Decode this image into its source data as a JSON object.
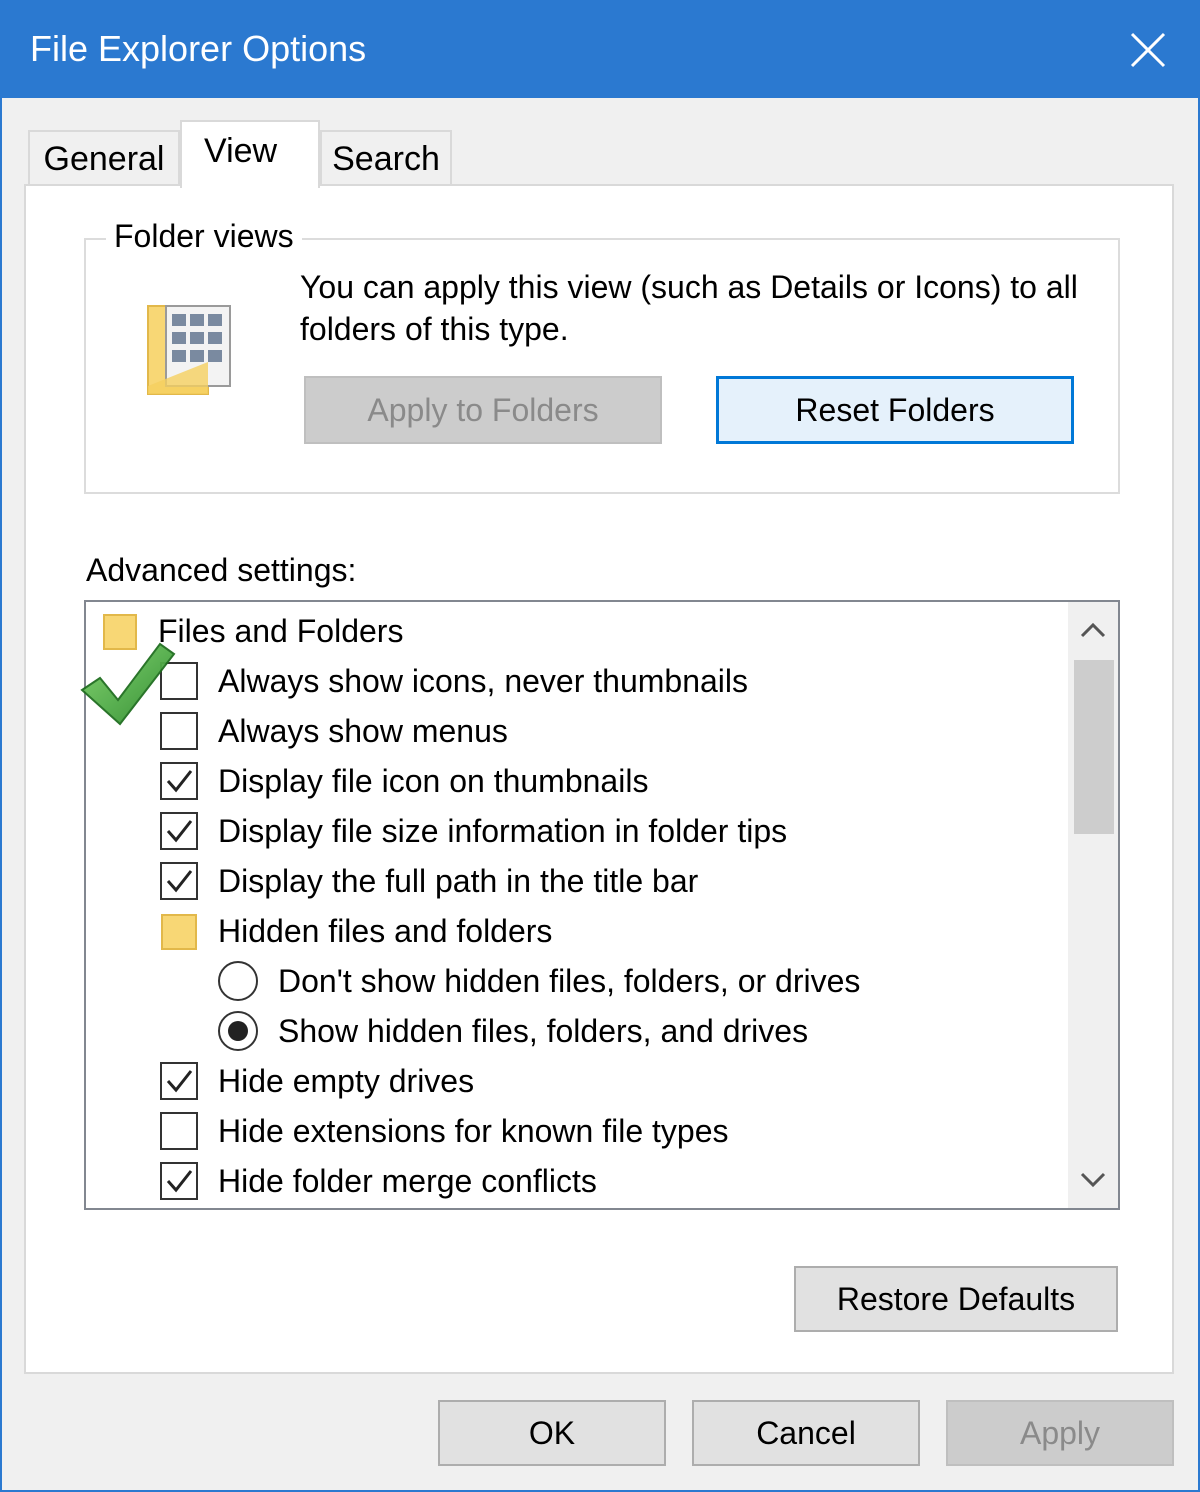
{
  "window": {
    "title": "File Explorer Options"
  },
  "tabs": [
    {
      "label": "General"
    },
    {
      "label": "View"
    },
    {
      "label": "Search"
    }
  ],
  "folder_views": {
    "legend": "Folder views",
    "description": "You can apply this view (such as Details or Icons) to all folders of this type.",
    "apply_button": "Apply to Folders",
    "reset_button": "Reset Folders"
  },
  "advanced": {
    "label": "Advanced settings:",
    "items": [
      {
        "type": "folder",
        "label": "Files and Folders"
      },
      {
        "type": "checkbox",
        "label": "Always show icons, never thumbnails",
        "checked": false
      },
      {
        "type": "checkbox",
        "label": "Always show menus",
        "checked": false
      },
      {
        "type": "checkbox",
        "label": "Display file icon on thumbnails",
        "checked": true
      },
      {
        "type": "checkbox",
        "label": "Display file size information in folder tips",
        "checked": true
      },
      {
        "type": "checkbox",
        "label": "Display the full path in the title bar",
        "checked": true
      },
      {
        "type": "folder",
        "label": "Hidden files and folders"
      },
      {
        "type": "radio",
        "label": "Don't show hidden files, folders, or drives",
        "selected": false
      },
      {
        "type": "radio",
        "label": "Show hidden files, folders, and drives",
        "selected": true
      },
      {
        "type": "checkbox",
        "label": "Hide empty drives",
        "checked": true
      },
      {
        "type": "checkbox",
        "label": "Hide extensions for known file types",
        "checked": false
      },
      {
        "type": "checkbox",
        "label": "Hide folder merge conflicts",
        "checked": true
      }
    ]
  },
  "restore_defaults": "Restore Defaults",
  "footer": {
    "ok": "OK",
    "cancel": "Cancel",
    "apply": "Apply"
  },
  "colors": {
    "titlebar": "#2b79d0",
    "focus_border": "#0078d7",
    "folder": "#f8d775",
    "annotation_check": "#3aa335"
  },
  "icons": {
    "close": "close-icon",
    "annotation": "green-checkmark-icon"
  }
}
